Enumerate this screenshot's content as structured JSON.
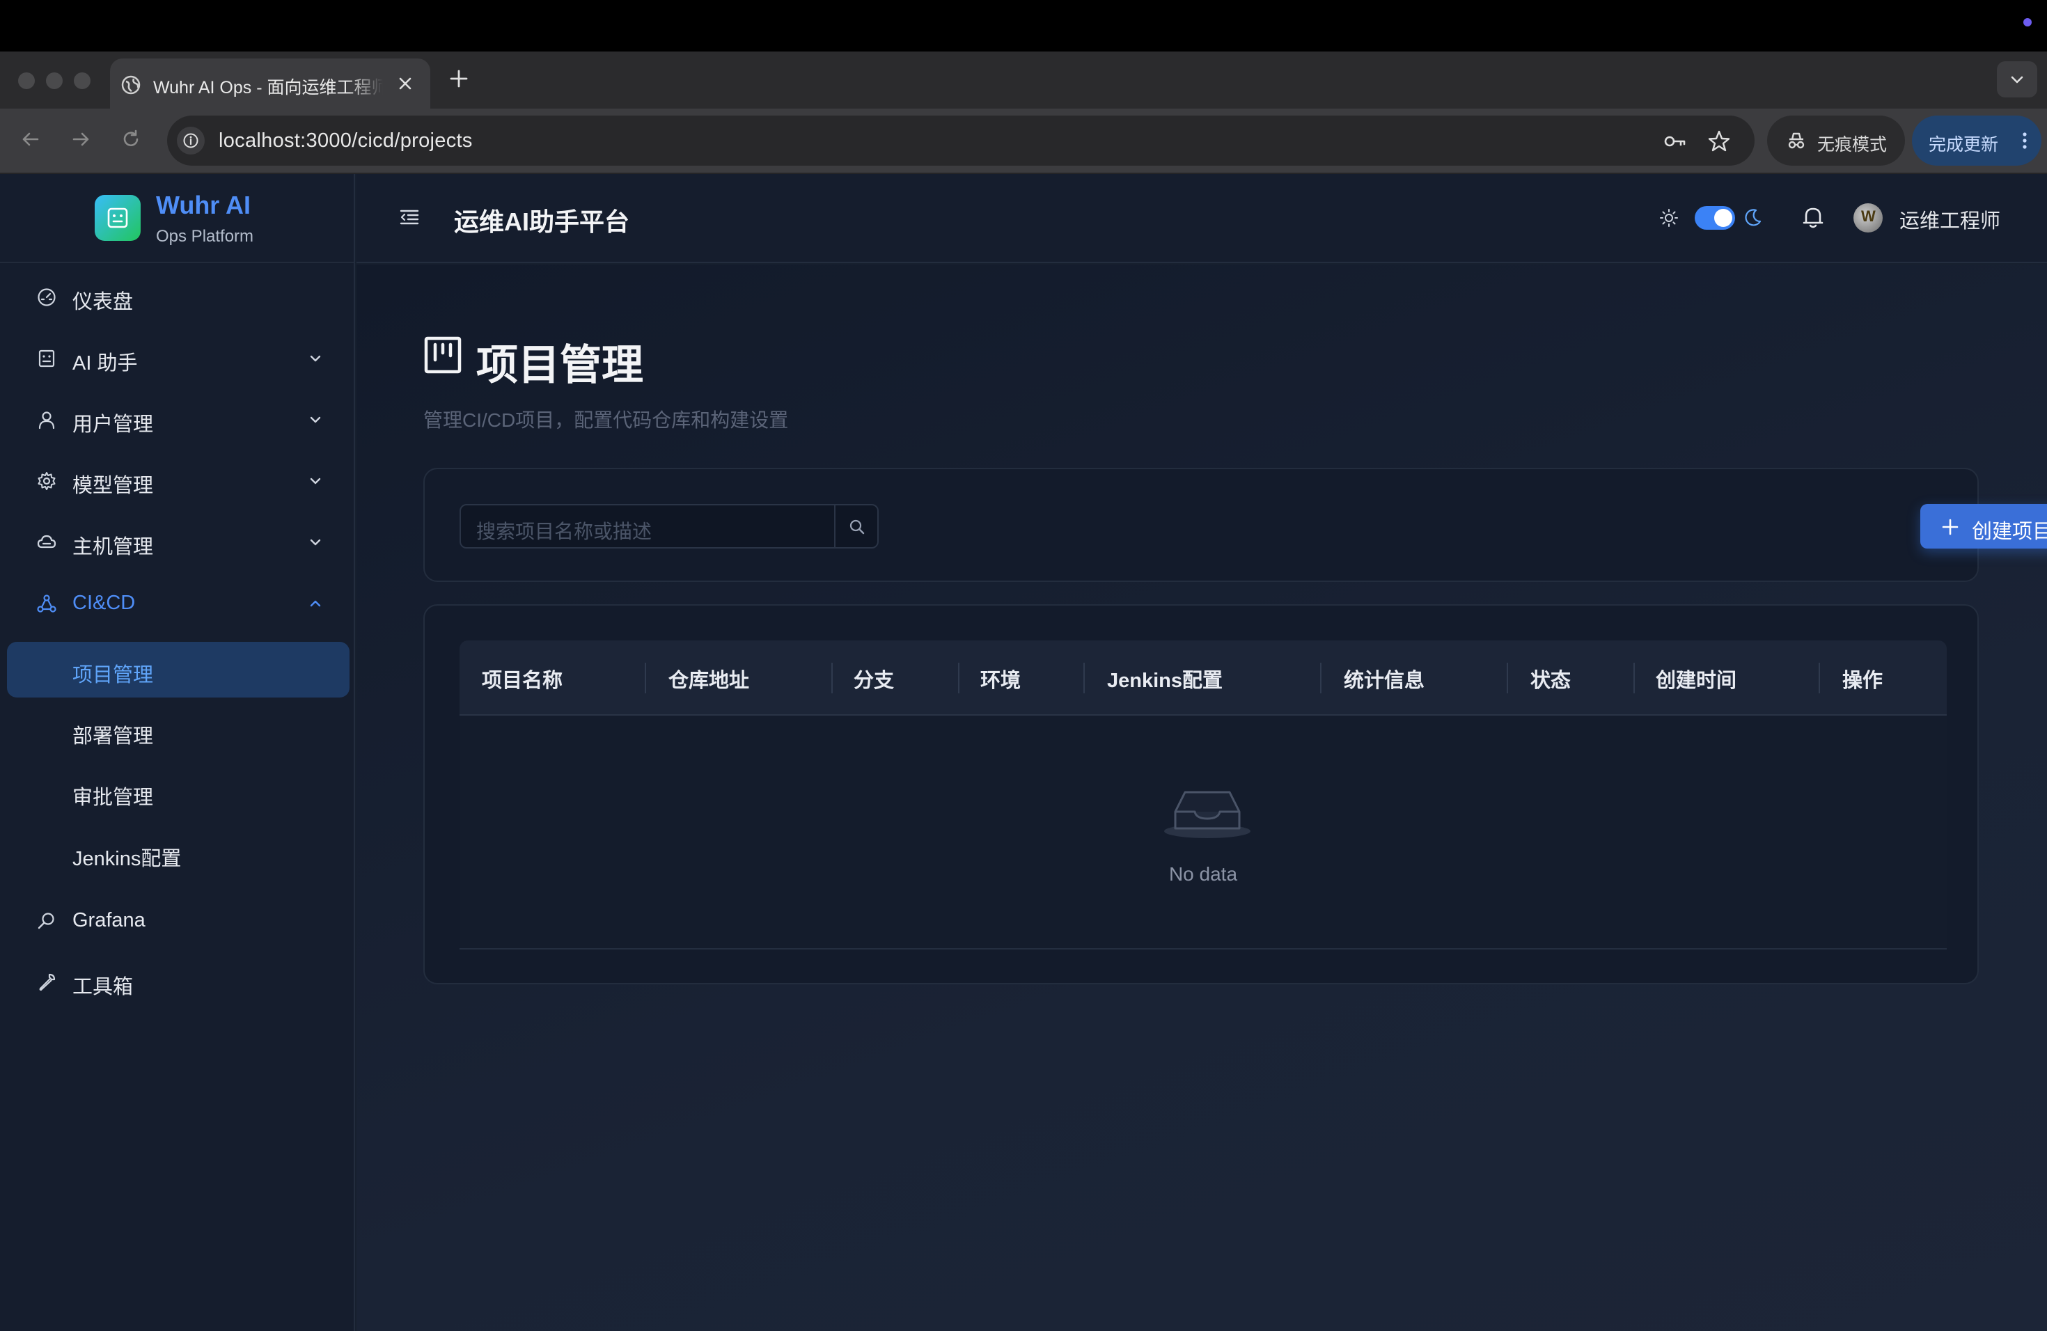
{
  "browser": {
    "tab_title": "Wuhr AI Ops - 面向运维工程师",
    "url": "localhost:3000/cicd/projects",
    "incognito_label": "无痕模式",
    "update_label": "完成更新"
  },
  "sidebar": {
    "logo_title": "Wuhr AI",
    "logo_subtitle": "Ops Platform",
    "items": [
      {
        "label": "仪表盘",
        "icon": "dashboard-icon"
      },
      {
        "label": "AI 助手",
        "icon": "robot-icon"
      },
      {
        "label": "用户管理",
        "icon": "user-icon"
      },
      {
        "label": "模型管理",
        "icon": "gear-icon"
      },
      {
        "label": "主机管理",
        "icon": "cloud-icon"
      },
      {
        "label": "CI&CD",
        "icon": "cicd-icon"
      },
      {
        "label": "Grafana",
        "icon": "magnifier-icon"
      },
      {
        "label": "工具箱",
        "icon": "wrench-icon"
      }
    ],
    "cicd_children": [
      {
        "label": "项目管理"
      },
      {
        "label": "部署管理"
      },
      {
        "label": "审批管理"
      },
      {
        "label": "Jenkins配置"
      }
    ]
  },
  "header": {
    "title": "运维AI助手平台",
    "user_name": "运维工程师",
    "avatar_glyph": "W",
    "theme_dark": true
  },
  "page": {
    "title": "项目管理",
    "description": "管理CI/CD项目，配置代码仓库和构建设置",
    "search_placeholder": "搜索项目名称或描述",
    "create_button": "创建项目",
    "table": {
      "columns": [
        "项目名称",
        "仓库地址",
        "分支",
        "环境",
        "Jenkins配置",
        "统计信息",
        "状态",
        "创建时间",
        "操作"
      ],
      "rows": [],
      "empty_text": "No data"
    }
  },
  "colors": {
    "accent": "#3b82f6",
    "active_text": "#60a5fa",
    "active_bg": "#1e3a63",
    "sidebar_bg": "#151d2d"
  }
}
